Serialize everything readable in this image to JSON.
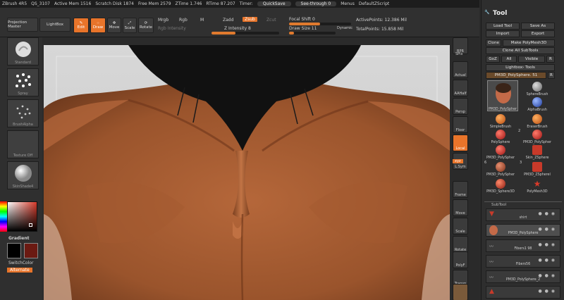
{
  "status": {
    "app": "ZBrush 4R5",
    "qs": "QS_3107",
    "active_mem": "Active Mem 1516",
    "scratch_disk": "Scratch Disk 1874",
    "free_mem": "Free Mem 2579",
    "ztime": "ZTime 1.746",
    "rtime": "RTime 87.207",
    "timer": "Timer:",
    "quicksave": "QuickSave",
    "see_through": "See-through",
    "see_through_val": "0",
    "menus": "Menus",
    "script": "DefaultZScript"
  },
  "toolbar": {
    "projection_master": "Projection Master",
    "lightbox": "LightBox",
    "edit": "Edit",
    "draw": "Draw",
    "move": "Move",
    "scale": "Scale",
    "rotate": "Rotate",
    "mrgb": "Mrgb",
    "rgb": "Rgb",
    "m": "M",
    "rgb_intensity": "Rgb Intensity",
    "zadd": "Zadd",
    "zsub": "Zsub",
    "zcut": "Zcut",
    "z_intensity": "Z Intensity 8",
    "z_intensity_value": 0.35,
    "focal_shift": "Focal Shift 0",
    "focal_shift_value": 0.5,
    "draw_size": "Draw Size 11",
    "draw_size_value": 0.1,
    "dynamic": "Dynamic",
    "active_points": "ActivePoints: 12.386 Mil",
    "total_points": "TotalPoints: 15.858 Mil"
  },
  "left": {
    "brush": "Standard",
    "stroke": "Spray",
    "alpha": "BrushAlpha",
    "texture": "Texture Off",
    "material": "SkinShade4",
    "gradient": "Gradient",
    "switch_color": "SwitchColor",
    "alternate": "Alternate",
    "colors": {
      "main": "#000000",
      "secondary": "#6b1a12"
    }
  },
  "right": {
    "bpr": "BPR",
    "spix": "SPix",
    "actual": "Actual",
    "aahalf": "AAHalf",
    "persp": "Persp",
    "floor": "Floor",
    "local": "Local",
    "lsym": "L.Sym",
    "xyz": "xyz",
    "frame": "Frame",
    "move": "Move",
    "scale": "Scale",
    "rotate": "Rotate",
    "polyf": "PolyF",
    "transp": "Transp"
  },
  "tool": {
    "title": "Tool",
    "load": "Load Tool",
    "save_as": "Save As",
    "import": "Import",
    "export": "Export",
    "clone": "Clone",
    "make_polymesh": "Make PolyMesh3D",
    "clone_all": "Clone All SubTools",
    "goz": "GoZ",
    "all": "All",
    "visible": "Visible",
    "r": "R",
    "lightbox_tools": "Lightbox› Tools",
    "current": "PM3D_PolySphere. 51",
    "current_r": "R",
    "items": [
      "PM3D_PolySpher",
      "SphereBrush",
      "AlphaBrush",
      "SimpleBrush",
      "EraserBrush",
      "PolySphere",
      "PM3D_PolySpher",
      "PM3D_PolySpher",
      "Skin_ZSphere",
      "PM3D_PolySpher",
      "PM3D_ZSpherel",
      "PM3D_Sphere3D",
      "PolyMesh3D"
    ],
    "numbers": [
      "2",
      "6",
      "3"
    ]
  },
  "subtool": {
    "title": "SubTool",
    "items": [
      "shirt",
      "PM3D_PolySphere",
      "Fibers1 98",
      "Fibers56",
      "PM3D_PolySphere_2",
      ""
    ]
  }
}
